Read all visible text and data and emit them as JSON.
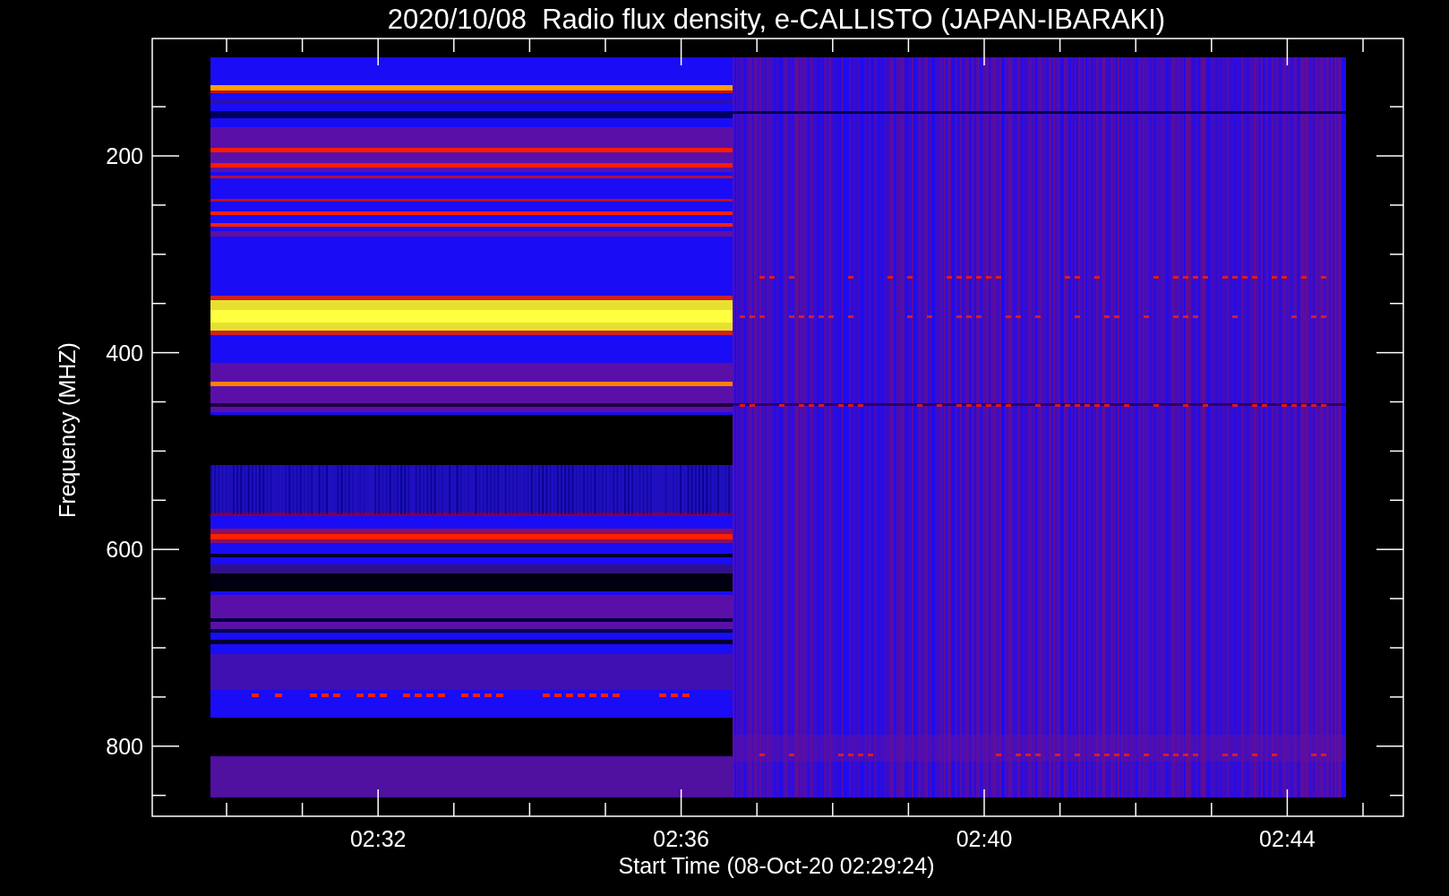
{
  "title": "2020/10/08  Radio flux density, e-CALLISTO (JAPAN-IBARAKI)",
  "y_axis": {
    "label": "Frequency (MHZ)",
    "ticks": [
      "200",
      "400",
      "600",
      "800"
    ]
  },
  "x_axis": {
    "label": "Start Time (08-Oct-20 02:29:24)",
    "ticks": [
      "02:32",
      "02:36",
      "02:40",
      "02:44"
    ]
  }
}
